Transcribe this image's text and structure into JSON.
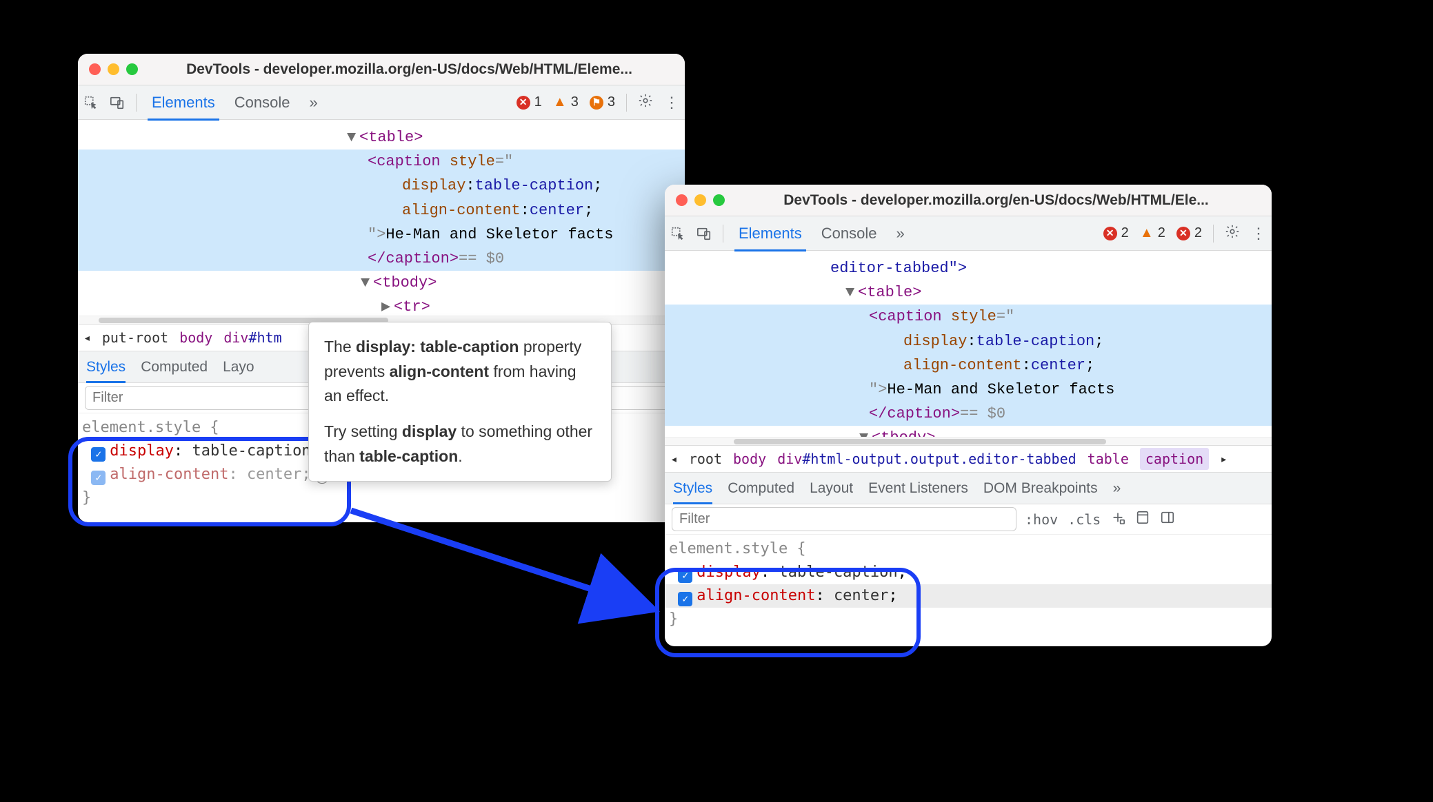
{
  "window1": {
    "title": "DevTools - developer.mozilla.org/en-US/docs/Web/HTML/Eleme...",
    "tabs": {
      "elements": "Elements",
      "console": "Console",
      "more": "»"
    },
    "counts": {
      "errors": "1",
      "warnings_tri": "3",
      "warnings_flag": "3"
    },
    "dom": {
      "l1": "<table>",
      "l2a": "<caption",
      "l2b": "style",
      "l2c": "=\"",
      "l3a": "display",
      "l3b": ": ",
      "l3c": "table-caption",
      "l3d": ";",
      "l4a": "align-content",
      "l4b": ": ",
      "l4c": "center",
      "l4d": ";",
      "l5a": "\"> ",
      "l5b": "He-Man and Skeletor facts",
      "l6a": "</caption>",
      "l6b": " == $0",
      "l7": "<tbody>",
      "l8": "<tr>"
    },
    "breadcrumb": {
      "back": "◂",
      "c1": "put-root",
      "c2": "body",
      "c3a": "div",
      "c3b": "#htm"
    },
    "subtabs": {
      "styles": "Styles",
      "computed": "Computed",
      "layout": "Layo"
    },
    "filter_placeholder": "Filter",
    "style_rule": "element.style {",
    "prop_display": "display",
    "val_display": "table-caption",
    "prop_align": "align-content",
    "val_align": "center",
    "brace": "}"
  },
  "tooltip": {
    "p1a": "The ",
    "p1b": "display: table-caption",
    "p1c": " property prevents ",
    "p1d": "align-content",
    "p1e": " from having an effect.",
    "p2a": "Try setting ",
    "p2b": "display",
    "p2c": " to something other than ",
    "p2d": "table-caption",
    "p2e": "."
  },
  "window2": {
    "title": "DevTools - developer.mozilla.org/en-US/docs/Web/HTML/Ele...",
    "tabs": {
      "elements": "Elements",
      "console": "Console",
      "more": "»"
    },
    "counts": {
      "errors": "2",
      "warnings_tri": "2",
      "warnings_flag": "2"
    },
    "dom": {
      "l0": "editor-tabbed\">",
      "l1": "<table>",
      "l2a": "<caption",
      "l2b": "style",
      "l2c": "=\"",
      "l3a": "display",
      "l3b": ": ",
      "l3c": "table-caption",
      "l3d": ";",
      "l4a": "align-content",
      "l4b": ": ",
      "l4c": "center",
      "l4d": ";",
      "l5a": "\"> ",
      "l5b": "He-Man and Skeletor facts",
      "l6a": "</caption>",
      "l6b": " == $0",
      "l7": "<tbody>"
    },
    "breadcrumb": {
      "back": "◂",
      "c1": "root",
      "c2": "body",
      "c3a": "div",
      "c3b": "#html-output.output.editor-tabbed",
      "c4": "table",
      "c5": "caption",
      "fwd": "▸"
    },
    "subtabs": {
      "styles": "Styles",
      "computed": "Computed",
      "layout": "Layout",
      "listeners": "Event Listeners",
      "dombp": "DOM Breakpoints",
      "more": "»"
    },
    "filter_placeholder": "Filter",
    "tools": {
      "hov": ":hov",
      "cls": ".cls"
    },
    "style_rule": "element.style {",
    "prop_display": "display",
    "val_display": "table-caption",
    "prop_align": "align-content",
    "val_align": "center",
    "brace": "}"
  }
}
